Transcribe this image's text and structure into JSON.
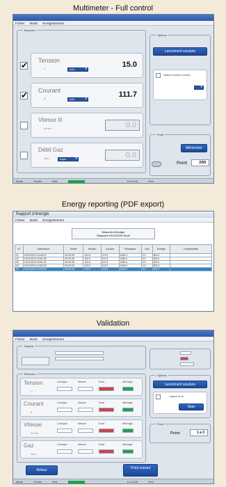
{
  "captions": {
    "multimeter": "Multimeter - Full control",
    "energy": "Energy reporting (PDF export)",
    "validation": "Validation"
  },
  "multimeter": {
    "menu": [
      "Fichier",
      "Mode",
      "Enregistrement"
    ],
    "group_left": "Mesures",
    "group_right_top": "Options",
    "group_right_bottom": "Point",
    "rows": [
      {
        "label": "Tension",
        "unit": "V",
        "range": "Auto",
        "value": "15.0",
        "checked": true
      },
      {
        "label": "Courant",
        "unit": "A",
        "range": "Auto",
        "value": "111.7",
        "checked": true
      },
      {
        "label": "Vitesse fil",
        "unit": "m/min",
        "range": "",
        "value": "0.0",
        "checked": false
      },
      {
        "label": "Débit Gaz",
        "unit": "l/min",
        "range": "Argon",
        "value": "0.0",
        "checked": false
      }
    ],
    "start_button": "Lancement soudure",
    "checkbox_text": "Capture soudure soudure",
    "memorize_button": "Mémoriser",
    "point_label": "Point",
    "point_value": "2/99",
    "small_button": "...",
    "status": [
      "Mode",
      "Fichier",
      "Etat",
      "14:22:05",
      "Pret"
    ]
  },
  "energy": {
    "title": "Rapport d'énergie",
    "menu": [
      "Fichier",
      "Mode",
      "Enregistrement"
    ],
    "header_line1": "Mesures d'énergie",
    "header_line2": "Rapports 19/11/2019 Hvolt",
    "columns": [
      "N°",
      "Date/Heure",
      "Durée",
      "Tension",
      "Courant",
      "Puissance",
      "Gaz",
      "Energie",
      "Commentaire"
    ],
    "rows": [
      [
        "01",
        "19/11/2019 15:46:42",
        "00:00:05",
        "102.6",
        "101.5",
        "1060.4",
        "0.0",
        "500.4",
        ""
      ],
      [
        "02",
        "19/11/2019 15:51:08",
        "00:00:05",
        "102.6",
        "101.5",
        "1060.4",
        "0.0",
        "500.4",
        ""
      ],
      [
        "03",
        "19/11/2019 15:51:30",
        "00:00:05",
        "102.6",
        "101.5",
        "1060.4",
        "0.0",
        "500.4",
        ""
      ],
      [
        "04",
        "19/11/2019 15:52:06",
        "00:00:05",
        "102.6",
        "101.5",
        "1060.4",
        "0.0",
        "500.4",
        ""
      ],
      [
        "05",
        "19/11/2019 15:53:39",
        "00:00:05",
        "102.6",
        "101.5",
        "1060.4",
        "0.0",
        "500.4",
        ""
      ]
    ],
    "selected_row": 4
  },
  "validation": {
    "menu": [
      "Fichier",
      "Mode",
      "Enregistrement"
    ],
    "group_top": "Repère",
    "group_measures": "Mesures",
    "group_options": "Options",
    "group_point": "Point",
    "rows": [
      {
        "label": "Tension",
        "unit": "V",
        "cols": [
          "Consigne",
          "Mesure",
          "Ecart",
          "Affichage"
        ]
      },
      {
        "label": "Courant",
        "unit": "A",
        "cols": [
          "Consigne",
          "Mesure",
          "Ecart",
          "Affichage"
        ]
      },
      {
        "label": "Vitesse",
        "unit": "m/min",
        "cols": [
          "Consigne",
          "Mesure",
          "Ecart",
          "Affichage"
        ]
      },
      {
        "label": "Gaz",
        "unit": "l/min",
        "cols": [
          "Consigne",
          "Mesure",
          "Ecart",
          "Affichage"
        ]
      }
    ],
    "start_button": "Lancement soudure",
    "checkbox_text": "Capture du fil",
    "start_small": "Start",
    "point_label": "Point",
    "point_value": "1 a 3",
    "back_button": "Retour",
    "next_button": "Point suivant",
    "status": [
      "Mode",
      "Fichier",
      "Etat",
      "14:22:05",
      "Pret"
    ]
  }
}
